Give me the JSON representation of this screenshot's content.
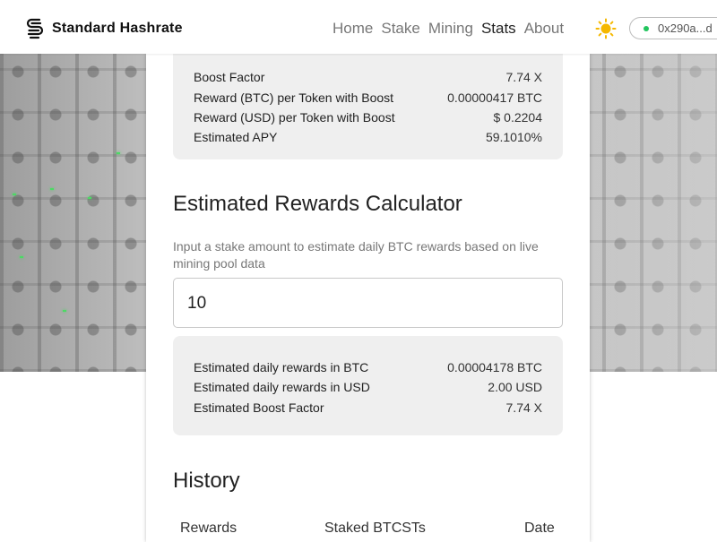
{
  "header": {
    "brand": "Standard Hashrate",
    "nav": [
      "Home",
      "Stake",
      "Mining",
      "Stats",
      "About"
    ],
    "active_nav": "Stats",
    "wallet_address": "0x290a...d",
    "wallet_status_color": "#22c55e"
  },
  "boost_stats": {
    "rows": [
      {
        "label": "Boost Factor",
        "value": "7.74 X"
      },
      {
        "label": "Reward (BTC) per Token with Boost",
        "value": "0.00000417 BTC"
      },
      {
        "label": "Reward (USD) per Token with Boost",
        "value": "$ 0.2204"
      },
      {
        "label": "Estimated APY",
        "value": "59.1010%"
      }
    ]
  },
  "calculator": {
    "title": "Estimated Rewards Calculator",
    "description": "Input a stake amount to estimate daily BTC rewards based on live mining pool data",
    "input_value": "10",
    "results": [
      {
        "label": "Estimated daily rewards in BTC",
        "value": "0.00004178 BTC"
      },
      {
        "label": "Estimated daily rewards in USD",
        "value": "2.00 USD"
      },
      {
        "label": "Estimated Boost Factor",
        "value": "7.74 X"
      }
    ]
  },
  "history": {
    "title": "History",
    "columns": [
      "Rewards",
      "Staked BTCSTs",
      "Date"
    ]
  },
  "colors": {
    "panel_bg": "#efefef",
    "accent_sun": "#f5b800"
  }
}
